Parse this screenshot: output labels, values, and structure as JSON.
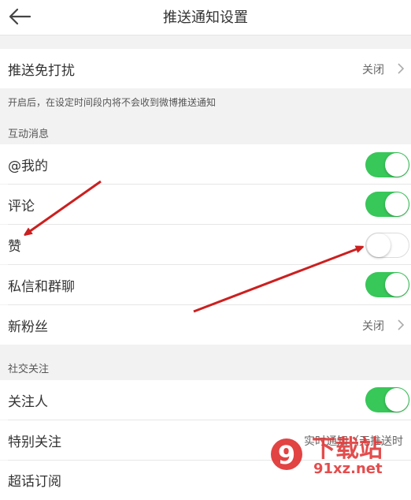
{
  "header": {
    "title": "推送通知设置",
    "back_icon": "back-arrow-icon"
  },
  "dnd": {
    "label": "推送免打扰",
    "value": "关闭",
    "note": "开启后，在设定时间段内将不会收到微博推送通知"
  },
  "interaction": {
    "section_label": "互动消息",
    "items": [
      {
        "label": "@我的",
        "toggle": true
      },
      {
        "label": "评论",
        "toggle": true
      },
      {
        "label": "赞",
        "toggle": false
      },
      {
        "label": "私信和群聊",
        "toggle": true
      },
      {
        "label": "新粉丝",
        "value": "关闭"
      }
    ]
  },
  "social": {
    "section_label": "社交关注",
    "items": [
      {
        "label": "关注人",
        "toggle": true
      },
      {
        "label": "特别关注",
        "value": "实时通知（无推送时"
      },
      {
        "label": "超话订阅"
      }
    ]
  },
  "colors": {
    "toggle_on": "#38c759",
    "annotation_arrow": "#cc1f1f"
  },
  "watermark": {
    "brand": "下载站",
    "domain": "91xz.net",
    "logo_digit": "9"
  }
}
